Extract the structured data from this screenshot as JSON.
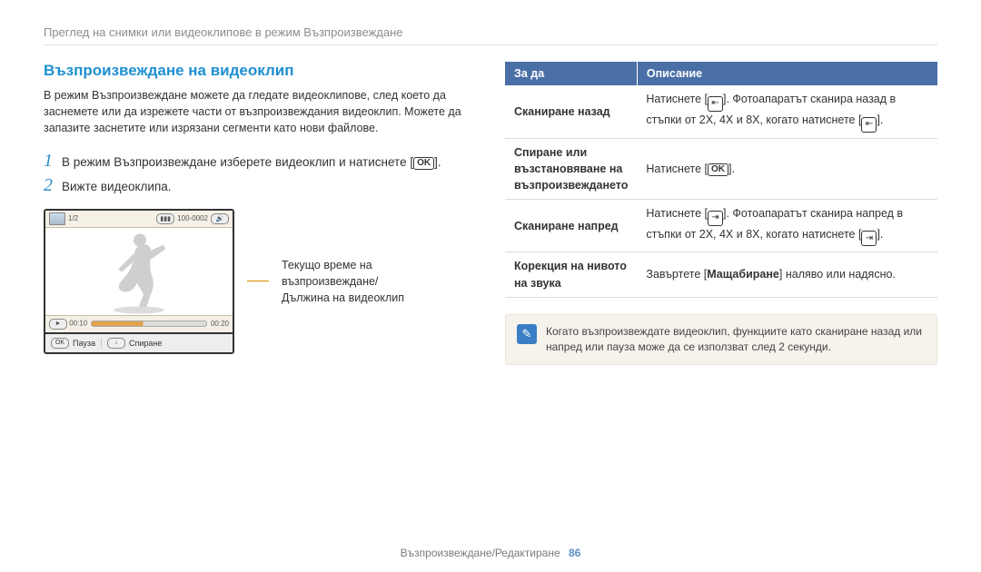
{
  "breadcrumb": "Преглед на снимки или видеоклипове в режим Възпроизвеждане",
  "title": "Възпроизвеждане на видеоклип",
  "intro": "В режим Възпроизвеждане можете да гледате видеоклипове, след което да заснемете или да изрежете части от възпроизвеждания видеоклип. Можете да запазите заснетите или изрязани сегменти като нови файлове.",
  "steps": {
    "s1": {
      "num": "1",
      "pre": "В режим Възпроизвеждане изберете видеоклип и натиснете [",
      "post": "]."
    },
    "s2": {
      "num": "2",
      "text": "Вижте видеоклипа."
    }
  },
  "lcd": {
    "counter": "1/2",
    "right_icons": "100-0002",
    "time_left": "00:10",
    "time_right": "00:20",
    "ok_label": "OK",
    "pause": "Пауза",
    "stop_icon": "↓",
    "stop": "Спиране",
    "play_glyph": "►"
  },
  "caption": "Текущо време на възпроизвеждане/ Дължина на видеоклип",
  "table": {
    "h1": "За да",
    "h2": "Описание",
    "rows": [
      {
        "label": "Сканиране назад",
        "pre": "Натиснете [",
        "glyph": "⇤",
        "mid": "]. Фотоапаратът сканира назад в стъпки от 2X, 4X и 8X, когато натиснете [",
        "post": "]."
      },
      {
        "label": "Спиране или възстановяване на възпроизвеждането",
        "pre": "Натиснете [",
        "glyph": "OK",
        "mid": "",
        "post": "]."
      },
      {
        "label": "Сканиране напред",
        "pre": "Натиснете [",
        "glyph": "⇥",
        "mid": "]. Фотоапаратът сканира напред в стъпки от 2X, 4X и 8X, когато натиснете [",
        "post": "]."
      },
      {
        "label": "Корекция на нивото на звука",
        "pre": "Завъртете [",
        "bold": "Мащабиране",
        "post": "] наляво или надясно."
      }
    ]
  },
  "note": {
    "icon": "✎",
    "text": "Когато възпроизвеждате видеоклип, функциите като сканиране назад или напред или пауза може да се използват след 2 секунди."
  },
  "footer": {
    "text": "Възпроизвеждане/Редактиране",
    "page": "86"
  }
}
